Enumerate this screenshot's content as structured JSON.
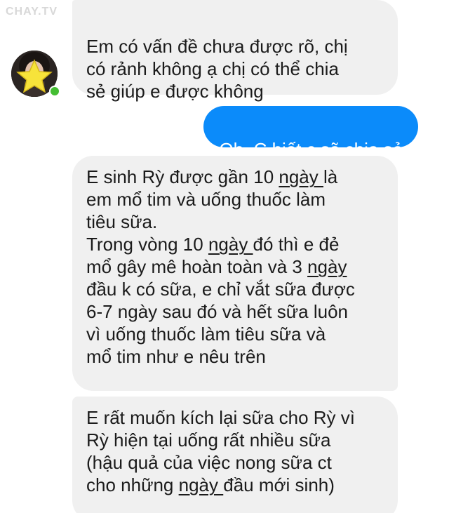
{
  "watermark": "CHAY.TV",
  "contact": {
    "avatar_icon": "profile-photo-with-star",
    "status": "online",
    "status_color": "#44bd32"
  },
  "colors": {
    "incoming_bubble": "#f0f0f0",
    "outgoing_bubble": "#0b8bfa"
  },
  "messages": [
    {
      "sender": "contact",
      "text": "Em có vấn đề chưa được rõ, chị\ncó rảnh không ạ chị có thể chia\nsẻ giúp e được không"
    },
    {
      "sender": "me",
      "text": "Oh. C biết c sẽ chia sẻ"
    },
    {
      "sender": "contact",
      "parts": [
        "E sinh Rỳ được gần 10 ",
        "ngày ",
        "là\nem mổ tim và uống thuốc làm\ntiêu sữa.\nTrong vòng 10 ",
        "ngày ",
        "đó thì e đẻ\nmổ gây mê hoàn toàn và 3 ",
        "ngày",
        "\nđầu k có sữa, e chỉ vắt sữa được\n6-7 ngày sau đó và hết sữa luôn\nvì uống thuốc làm tiêu sữa và\nmổ tim như e nêu trên"
      ]
    },
    {
      "sender": "contact",
      "parts": [
        "E rất muốn kích lại sữa cho Rỳ vì\nRỳ hiện tại uống rất nhiều sữa\n(hậu quả của việc nong sữa ct\ncho những ",
        "ngày ",
        "đầu mới sinh)"
      ]
    }
  ]
}
